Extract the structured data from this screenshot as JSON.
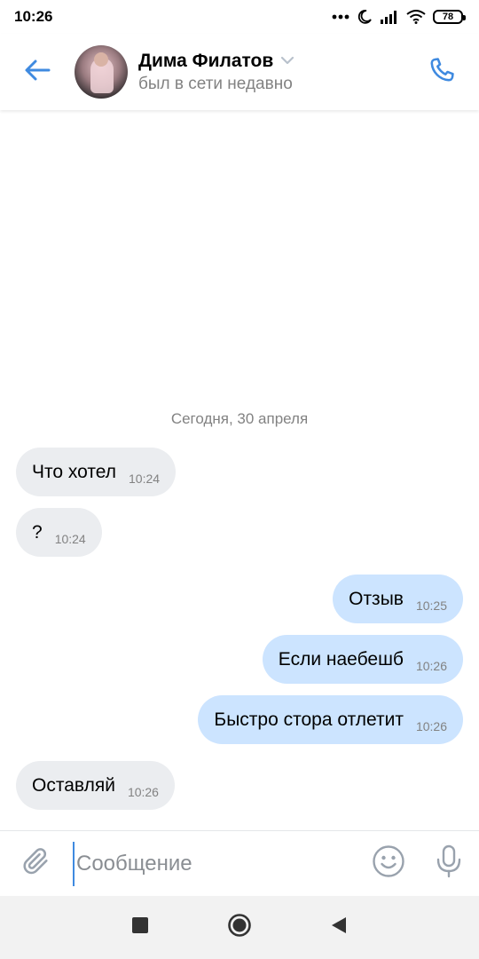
{
  "status_bar": {
    "time": "10:26",
    "battery": "78",
    "icons": [
      "dots-icon",
      "moon-icon",
      "signal-icon",
      "wifi-icon",
      "battery-icon"
    ]
  },
  "header": {
    "name": "Дима Филатов",
    "status": "был в сети недавно",
    "icons": {
      "back": "arrow-left-icon",
      "call": "phone-icon",
      "dropdown": "chevron-down-icon"
    }
  },
  "chat": {
    "date_separator": "Сегодня, 30 апреля",
    "messages": [
      {
        "direction": "in",
        "text": "Что хотел",
        "time": "10:24"
      },
      {
        "direction": "in",
        "text": "?",
        "time": "10:24"
      },
      {
        "direction": "out",
        "text": "Отзыв",
        "time": "10:25"
      },
      {
        "direction": "out",
        "text": "Если наебешб",
        "time": "10:26"
      },
      {
        "direction": "out",
        "text": "Быстро стора отлетит",
        "time": "10:26"
      },
      {
        "direction": "in",
        "text": "Оставляй",
        "time": "10:26"
      }
    ]
  },
  "composer": {
    "placeholder": "Сообщение",
    "value": "",
    "icons": {
      "attach": "paperclip-icon",
      "emoji": "smiley-icon",
      "mic": "microphone-icon"
    }
  },
  "nav_bar": {
    "icons": [
      "recents-square-icon",
      "home-circle-icon",
      "back-triangle-icon"
    ]
  },
  "colors": {
    "accent": "#3f8ae0",
    "incoming_bubble": "#ebedf0",
    "outgoing_bubble": "#cce4ff",
    "secondary_text": "#828282"
  }
}
